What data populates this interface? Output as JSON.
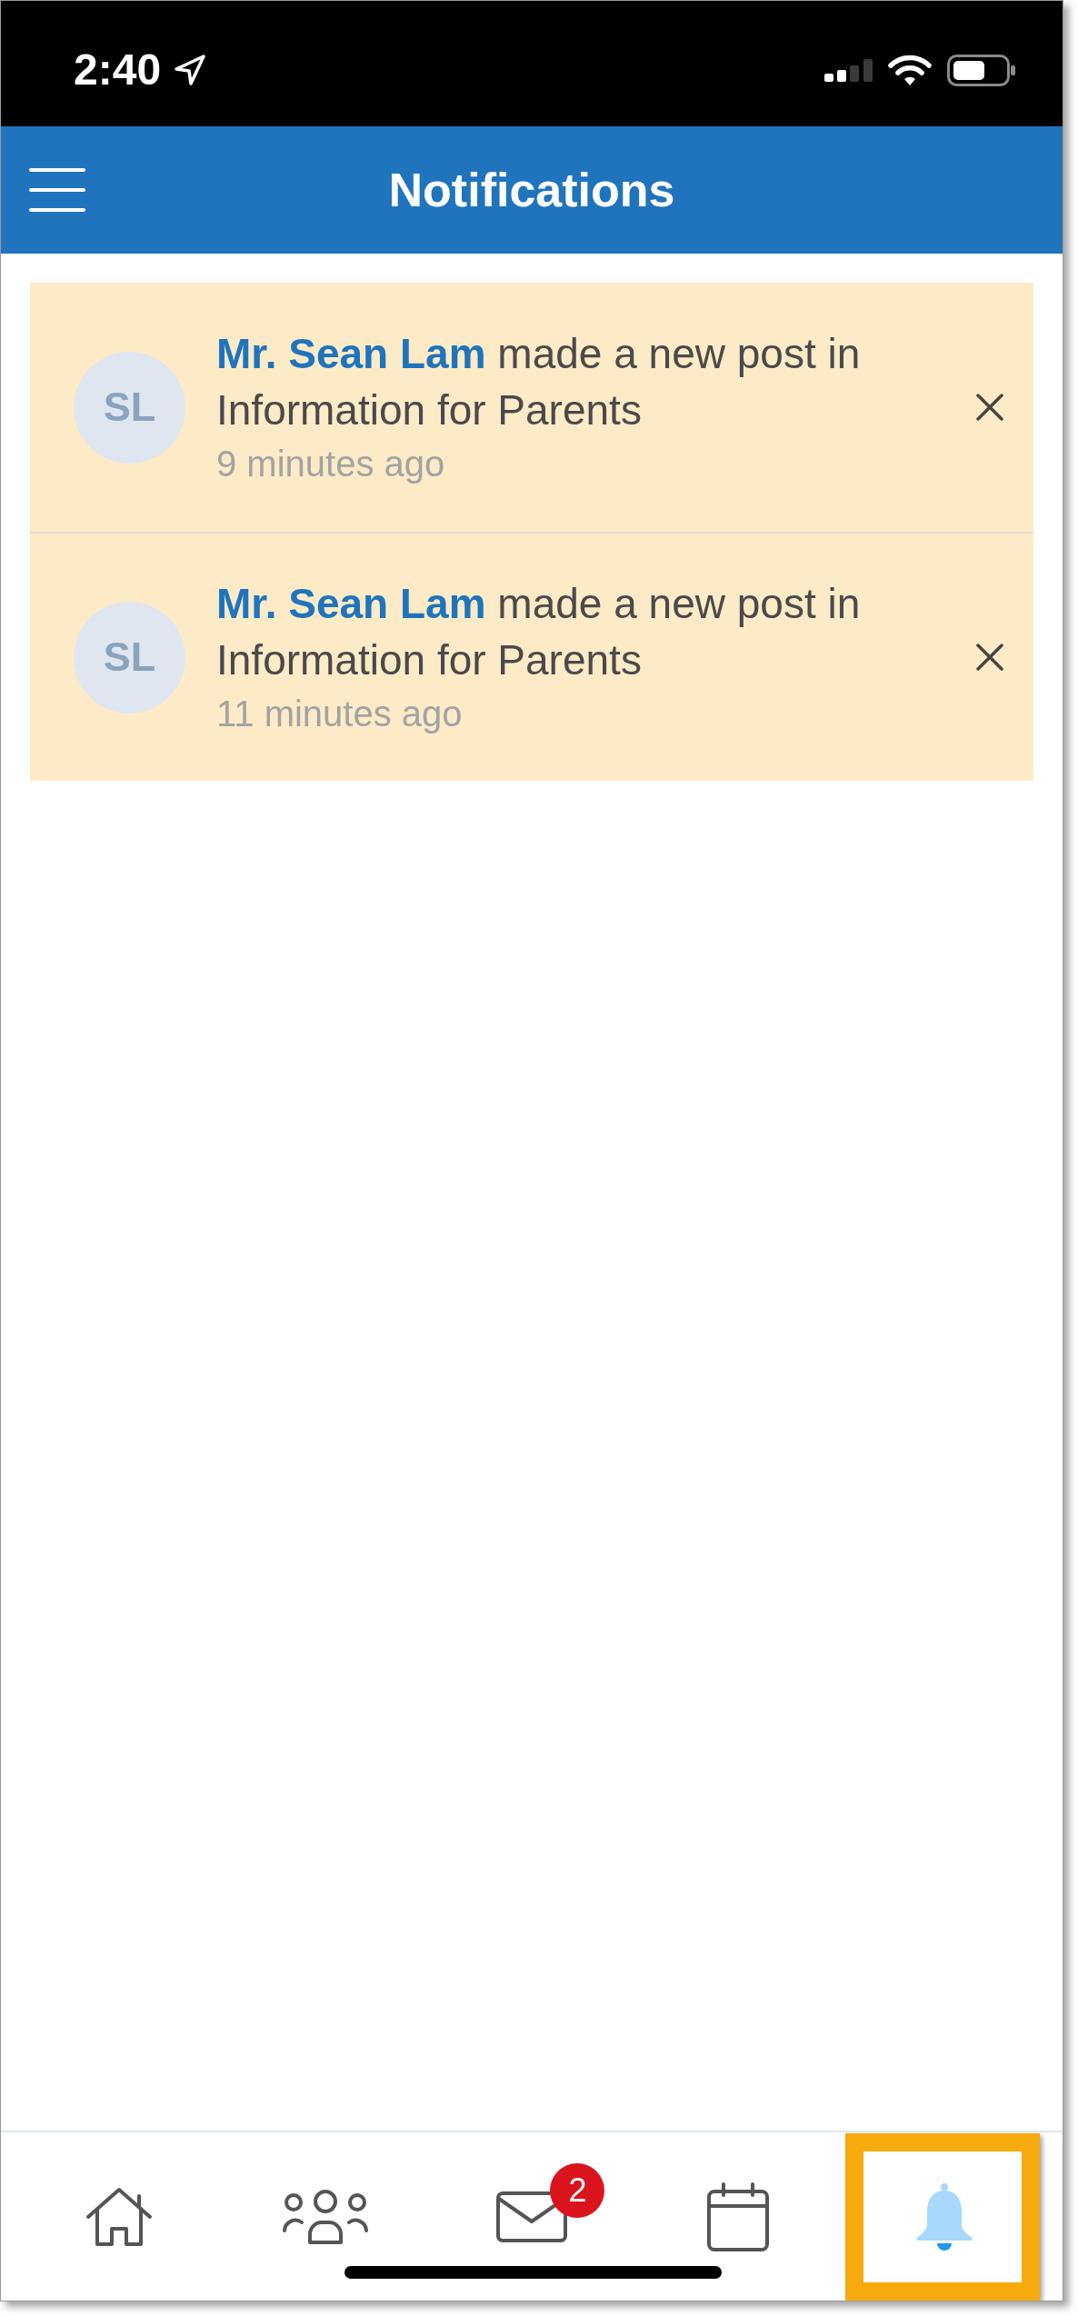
{
  "status_bar": {
    "time": "2:40"
  },
  "header": {
    "title": "Notifications"
  },
  "notifications": [
    {
      "initials": "SL",
      "text": "**Mr. Sean Lam** made a new post in Information for Parents",
      "time": "9 minutes ago",
      "unread": true
    },
    {
      "initials": "SL",
      "text": "**Mr. Sean Lam** made a new post in Information for Parents",
      "time": "11 minutes ago",
      "unread": true
    }
  ],
  "tab_bar": {
    "tabs": [
      {
        "kind": "home",
        "selected": false,
        "highlighted": false
      },
      {
        "kind": "groups",
        "selected": false,
        "highlighted": false
      },
      {
        "kind": "messages",
        "selected": false,
        "highlighted": false,
        "badge": "2"
      },
      {
        "kind": "calendar",
        "selected": false,
        "highlighted": false
      },
      {
        "kind": "notifications",
        "selected": true,
        "highlighted": true
      }
    ]
  }
}
